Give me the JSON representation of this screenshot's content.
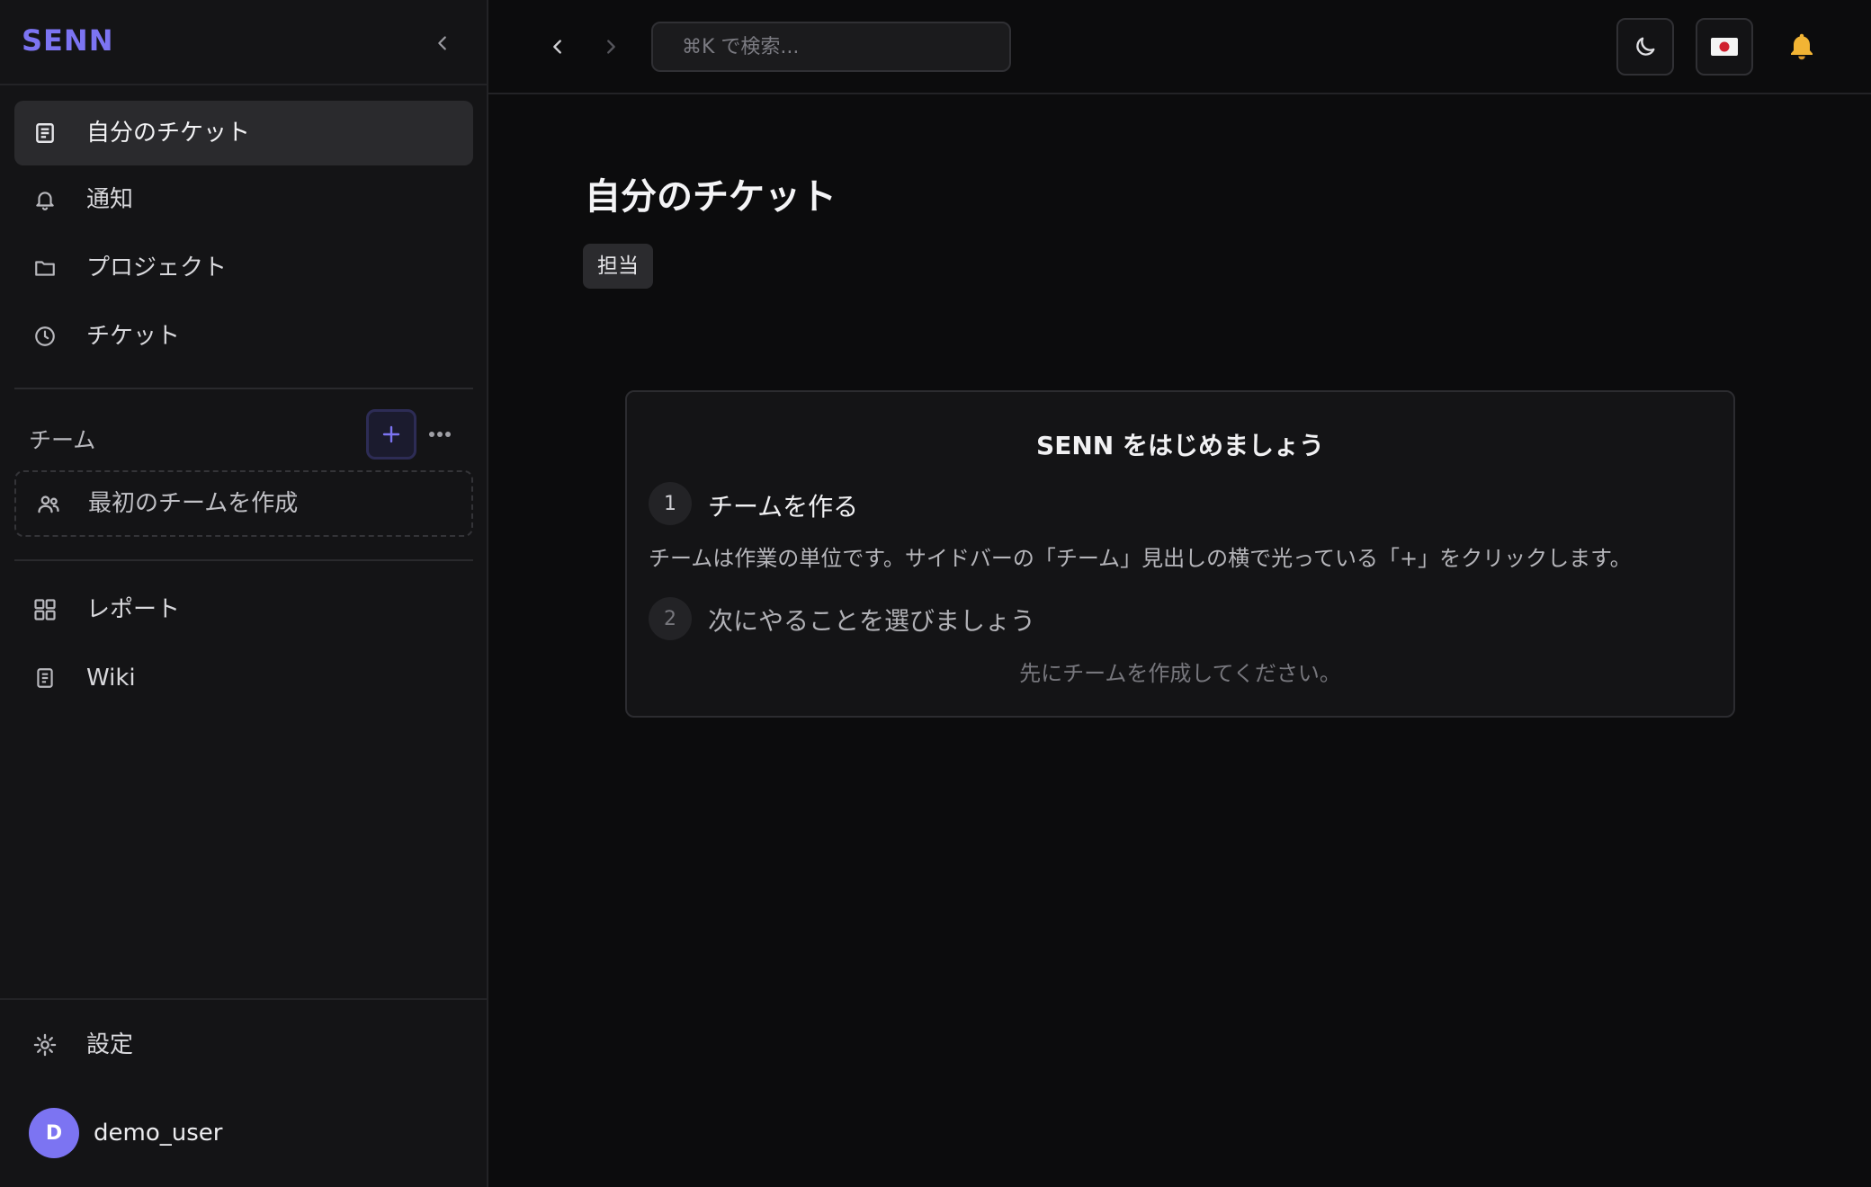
{
  "app": {
    "brand": "SENN"
  },
  "sidebar": {
    "nav": [
      {
        "label": "自分のチケット",
        "icon": "ticket-list-icon",
        "active": true
      },
      {
        "label": "通知",
        "icon": "bell-icon"
      },
      {
        "label": "プロジェクト",
        "icon": "folder-icon"
      },
      {
        "label": "チケット",
        "icon": "clock-icon"
      }
    ],
    "team_section": {
      "label": "チーム",
      "add_label": "+",
      "create_label": "最初のチームを作成"
    },
    "secondary": [
      {
        "label": "レポート",
        "icon": "grid-icon"
      },
      {
        "label": "Wiki",
        "icon": "document-icon"
      }
    ],
    "settings_label": "設定",
    "user": {
      "initial": "D",
      "name": "demo_user"
    }
  },
  "topbar": {
    "search_placeholder": "⌘K で検索...",
    "flag": "🇯🇵"
  },
  "main": {
    "title": "自分のチケット",
    "filter_tag": "担当",
    "onboarding": {
      "title": "SENN をはじめましょう",
      "steps": [
        {
          "num": "1",
          "title": "チームを作る",
          "desc": "チームは作業の単位です。サイドバーの「チーム」見出しの横で光っている「+」をクリックします。"
        },
        {
          "num": "2",
          "title": "次にやることを選びましょう",
          "note": "先にチームを作成してください。"
        }
      ]
    }
  },
  "colors": {
    "accent": "#7c74f2",
    "bg": "#0c0c0d",
    "sidebar": "#141416"
  }
}
